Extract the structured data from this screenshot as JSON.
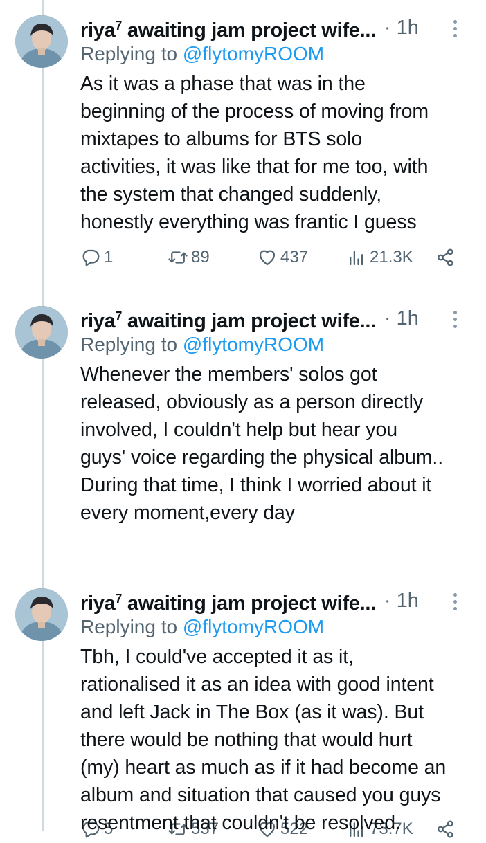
{
  "tweets": [
    {
      "author": "riya",
      "author_sup": "7",
      "author_rest": " awaiting jam project wife...",
      "time": "1h",
      "replying_prefix": "Replying to ",
      "replying_handle": "@flytomyROOM",
      "text": "As it was a phase that was in the\nbeginning of the process of moving from\nmixtapes to albums for BTS solo\nactivities, it was like that for me too, with\nthe system that changed suddenly,\nhonestly everything was frantic I guess",
      "replies": "1",
      "retweets": "89",
      "likes": "437",
      "views": "21.3K"
    },
    {
      "author": "riya",
      "author_sup": "7",
      "author_rest": " awaiting jam project wife...",
      "time": "1h",
      "replying_prefix": "Replying to ",
      "replying_handle": "@flytomyROOM",
      "text": "Whenever the members' solos got\nreleased, obviously as a person directly\ninvolved, I couldn't help but hear you\nguys' voice regarding the physical album..\nDuring that time, I think I worried about it\nevery moment,every day",
      "replies": "5",
      "retweets": "537",
      "likes": "522",
      "views": "73.7K"
    },
    {
      "author": "riya",
      "author_sup": "7",
      "author_rest": " awaiting jam project wife...",
      "time": "1h",
      "replying_prefix": "Replying to ",
      "replying_handle": "@flytomyROOM",
      "text": "Tbh, I could've accepted it as it,\nrationalised it as an idea with good intent\nand left Jack in The Box (as it was). But\nthere would be nothing that would hurt\n(my) heart as much as if it had become an\nalbum and situation that caused you guys\nresentment that couldn't be resolved."
    }
  ],
  "separator": "·",
  "icons": {
    "reply": "reply-icon",
    "retweet": "retweet-icon",
    "like": "heart-icon",
    "views": "views-icon",
    "share": "share-icon",
    "more": "more-icon"
  },
  "colors": {
    "text": "#0f1419",
    "secondary": "#536471",
    "link": "#1d9bf0",
    "thread_line": "#cfd9de"
  }
}
